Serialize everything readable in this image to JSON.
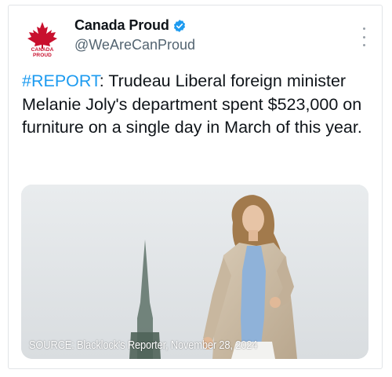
{
  "account": {
    "name": "Canada Proud",
    "handle": "@WeAreCanProud",
    "logo_text": "CANADA PROUD",
    "verified": true
  },
  "tweet": {
    "hashtag": "#REPORT",
    "body": ": Trudeau Liberal foreign minister Melanie Joly's department spent $523,000 on furniture on a single day in March of this year."
  },
  "media": {
    "caption": "SOURCE: Blacklock's Reporter, November 28, 2024"
  },
  "colors": {
    "link": "#1d9bf0",
    "verified_badge": "#1d9bf0",
    "logo_red": "#c8102e",
    "secondary_text": "#536471"
  },
  "icons": {
    "more": "more-vertical-icon",
    "verified": "verified-badge-icon",
    "logo": "maple-leaf-icon"
  }
}
